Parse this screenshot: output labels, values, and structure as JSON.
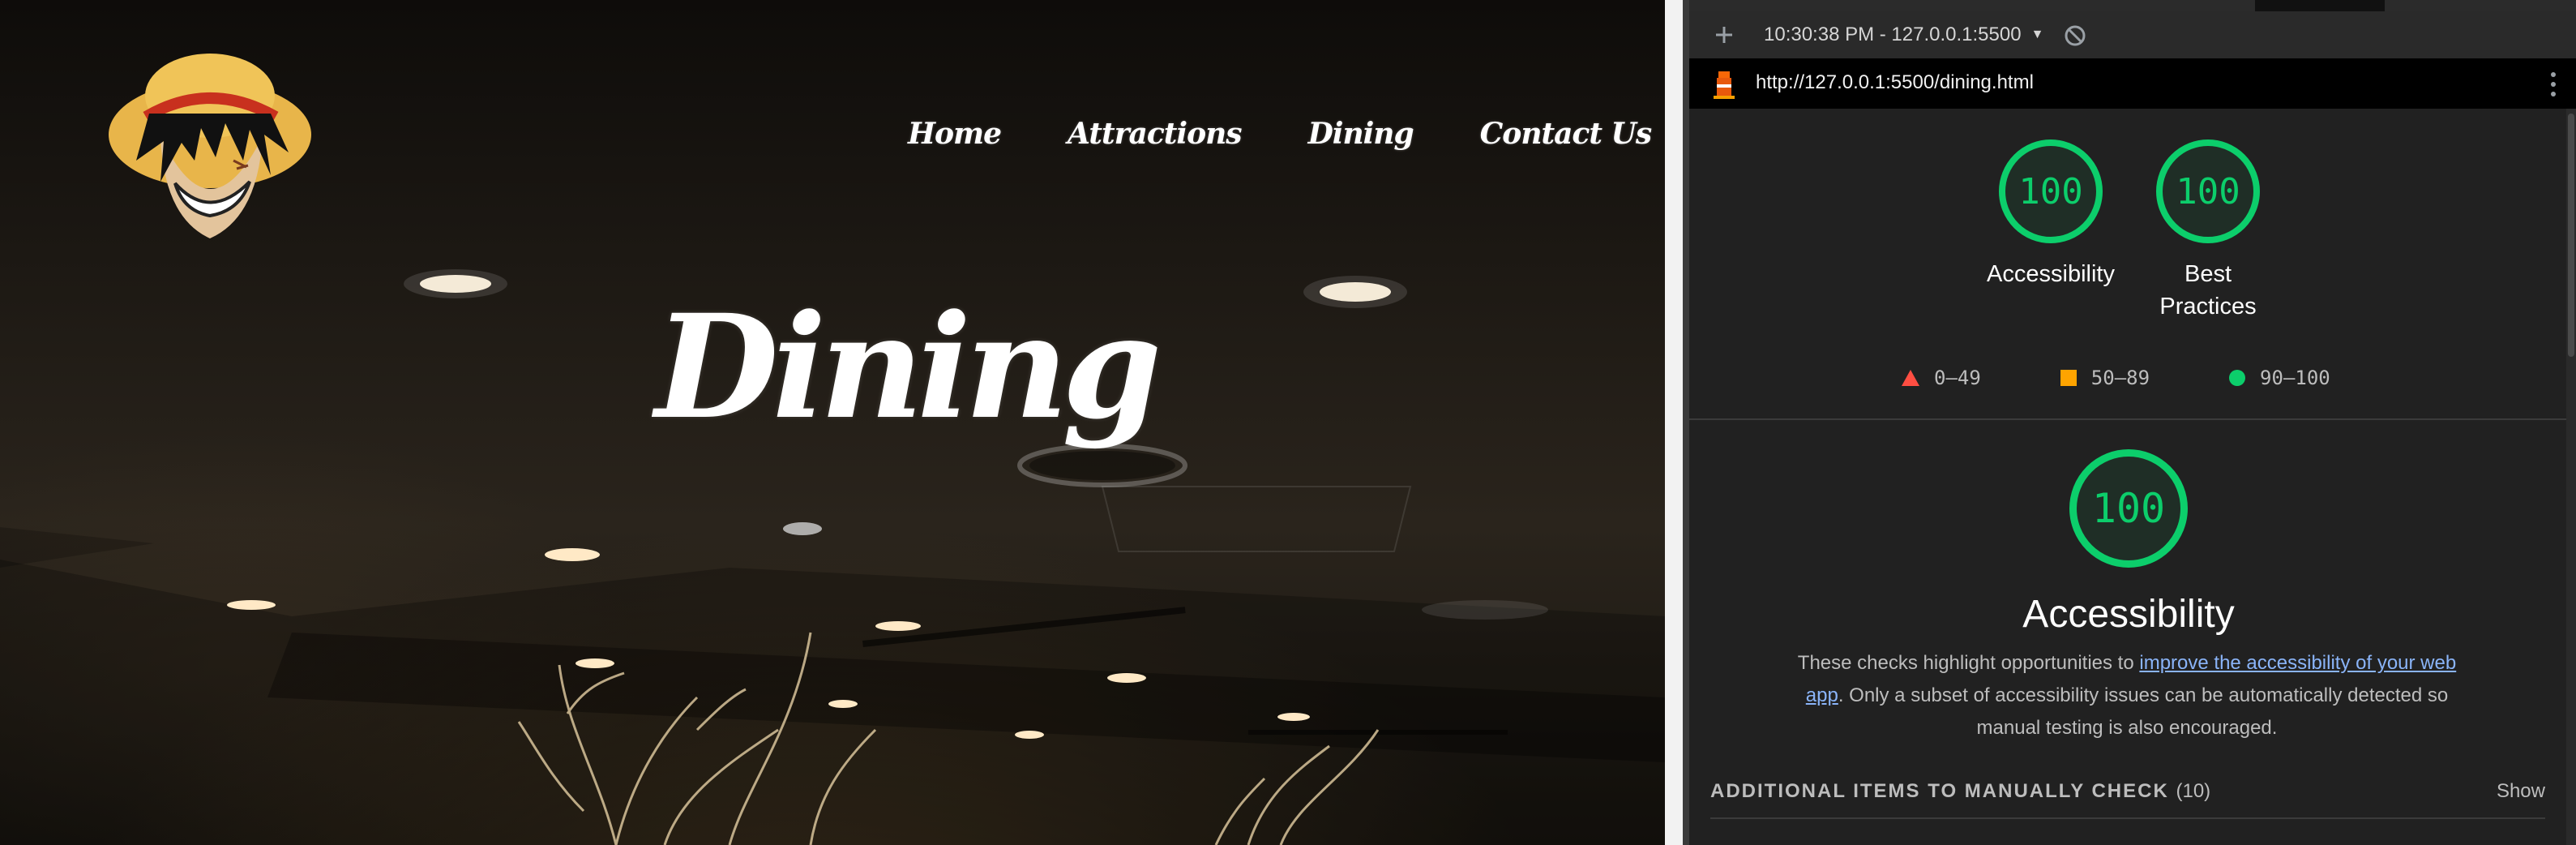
{
  "site": {
    "nav": [
      "Home",
      "Attractions",
      "Dining",
      "Contact Us"
    ],
    "hero_title": "Dining"
  },
  "lighthouse": {
    "toolbar": {
      "run_label": "10:30:38 PM - 127.0.0.1:5500"
    },
    "url": "http://127.0.0.1:5500/dining.html",
    "top_scores": [
      {
        "value": "100",
        "label": "Accessibility"
      },
      {
        "value": "100",
        "label": "Best Practices"
      }
    ],
    "legend": [
      "0–49",
      "50–89",
      "90–100"
    ],
    "main_score": {
      "value": "100",
      "title": "Accessibility"
    },
    "description": {
      "before": "These checks highlight opportunities to ",
      "link": "improve the accessibility of your web app",
      "after": ". Only a subset of accessibility issues can be automatically detected so manual testing is also encouraged."
    },
    "manual": {
      "heading": "ADDITIONAL ITEMS TO MANUALLY CHECK",
      "count": "(10)",
      "show": "Show"
    }
  },
  "colors": {
    "pass": "#0cce6b",
    "average": "#ffa400",
    "fail": "#ff4e42",
    "link": "#8ab4f8"
  },
  "icons": [
    "luffy-logo-icon",
    "plus-icon",
    "dropdown-caret-icon",
    "clear-icon",
    "lighthouse-favicon-icon",
    "kebab-menu-icon",
    "triangle-icon",
    "square-icon",
    "circle-icon"
  ]
}
